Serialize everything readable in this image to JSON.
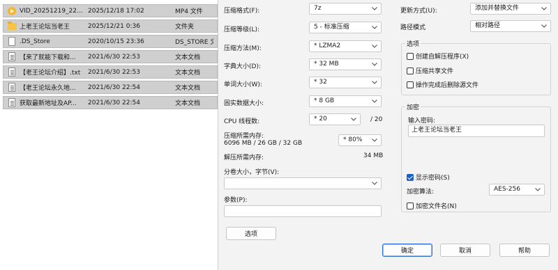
{
  "files": [
    {
      "name": "VID_20251219_22...",
      "date": "2025/12/18 17:02",
      "type": "MP4 文件",
      "icon": "video-icon"
    },
    {
      "name": "上老王论坛当老王",
      "date": "2025/12/21 0:36",
      "type": "文件夹",
      "icon": "folder-icon"
    },
    {
      "name": ".DS_Store",
      "date": "2020/10/15 23:36",
      "type": "DS_STORE 文",
      "icon": "file-icon"
    },
    {
      "name": "【来了就能下载和...",
      "date": "2021/6/30 22:53",
      "type": "文本文档",
      "icon": "text-doc-icon"
    },
    {
      "name": "【老王论坛介绍】.txt",
      "date": "2021/6/30 22:53",
      "type": "文本文档",
      "icon": "text-doc-icon"
    },
    {
      "name": "【老王论坛永久地...",
      "date": "2021/6/30 22:54",
      "type": "文本文档",
      "icon": "text-doc-icon"
    },
    {
      "name": "获取最新地址及AP...",
      "date": "2021/6/30 22:54",
      "type": "文本文档",
      "icon": "text-doc-icon"
    }
  ],
  "dialog": {
    "format_label": "压缩格式(F):",
    "format_value": "7z",
    "level_label": "压缩等级(L):",
    "level_value": "5 - 标准压缩",
    "method_label": "压缩方法(M):",
    "method_value": "* LZMA2",
    "dict_label": "字典大小(D):",
    "dict_value": "* 32 MB",
    "word_label": "单词大小(W):",
    "word_value": "* 32",
    "solid_label": "固实数据大小:",
    "solid_value": "* 8 GB",
    "threads_label": "CPU 线程数:",
    "threads_value": "* 20",
    "threads_max": "/ 20",
    "mem_comp_label": "压缩所需内存:",
    "mem_comp_detail": "6096 MB / 26 GB / 32 GB",
    "mem_percent": "* 80%",
    "mem_decomp_label": "解压所需内存:",
    "mem_decomp_value": "34 MB",
    "split_label": "分卷大小，字节(V):",
    "split_value": "",
    "params_label": "参数(P):",
    "params_value": "",
    "options_button": "选项",
    "update_label": "更新方式(U):",
    "update_value": "添加并替换文件",
    "path_label": "路径模式",
    "path_value": "相对路径",
    "options_group": "选项",
    "sfx_label": "创建自解压程序(X)",
    "sfx_checked": false,
    "shared_label": "压缩共享文件",
    "shared_checked": false,
    "delete_label": "操作完成后删除源文件",
    "delete_checked": false,
    "encrypt_group": "加密",
    "password_label": "输入密码:",
    "password_value": "上老王论坛当老王",
    "show_pw_label": "显示密码(S)",
    "show_pw_checked": true,
    "enc_method_label": "加密算法:",
    "enc_method_value": "AES-256",
    "enc_names_label": "加密文件名(N)",
    "enc_names_checked": false,
    "ok": "确定",
    "cancel": "取消",
    "help": "帮助"
  }
}
